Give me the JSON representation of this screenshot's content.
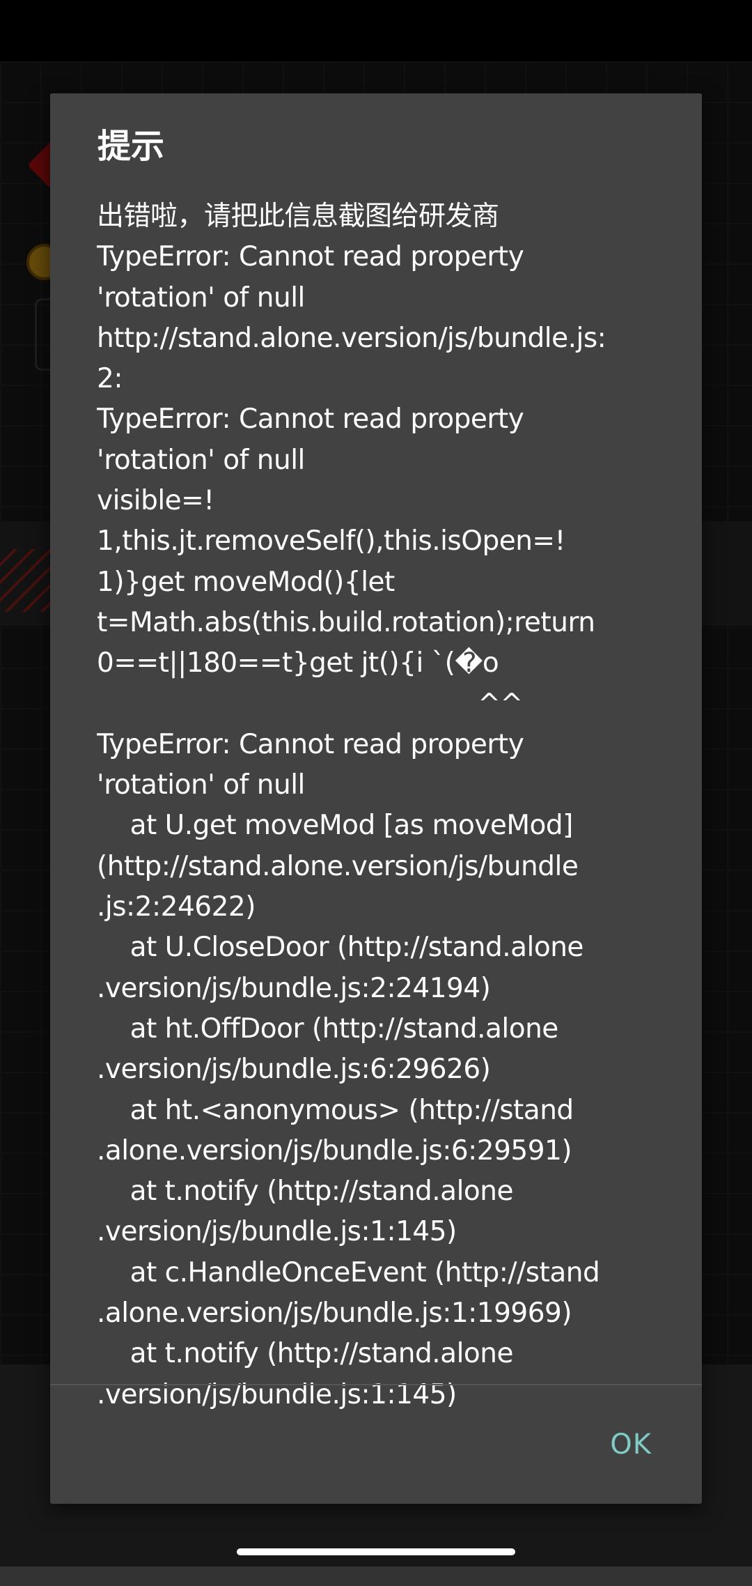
{
  "dialog": {
    "title": "提示",
    "lines": [
      "出错啦，请把此信息截图给研发商",
      "TypeError: Cannot read property",
      "'rotation' of null",
      "http://stand.alone.version/js/bundle.js:",
      "2:",
      "TypeError: Cannot read property",
      "'rotation' of null",
      "visible=!",
      "1,this.jt.removeSelf(),this.isOpen=!",
      "1)}get moveMod(){let",
      "t=Math.abs(this.build.rotation);return",
      "0==t||180==t}get jt(){i `(�o",
      "                                              ^^",
      "TypeError: Cannot read property",
      "'rotation' of null",
      "    at U.get moveMod [as moveMod]",
      "(http://stand.alone.version/js/bundle",
      ".js:2:24622)",
      "    at U.CloseDoor (http://stand.alone",
      ".version/js/bundle.js:2:24194)",
      "    at ht.OffDoor (http://stand.alone",
      ".version/js/bundle.js:6:29626)",
      "    at ht.<anonymous> (http://stand",
      ".alone.version/js/bundle.js:6:29591)",
      "    at t.notify (http://stand.alone",
      ".version/js/bundle.js:1:145)",
      "    at c.HandleOnceEvent (http://stand",
      ".alone.version/js/bundle.js:1:19969)",
      "    at t.notify (http://stand.alone",
      ".version/js/bundle.js:1:145)"
    ],
    "ok_label": "OK",
    "colors": {
      "background": "#424242",
      "text": "#ffffff",
      "accent": "#80cbc4"
    }
  }
}
